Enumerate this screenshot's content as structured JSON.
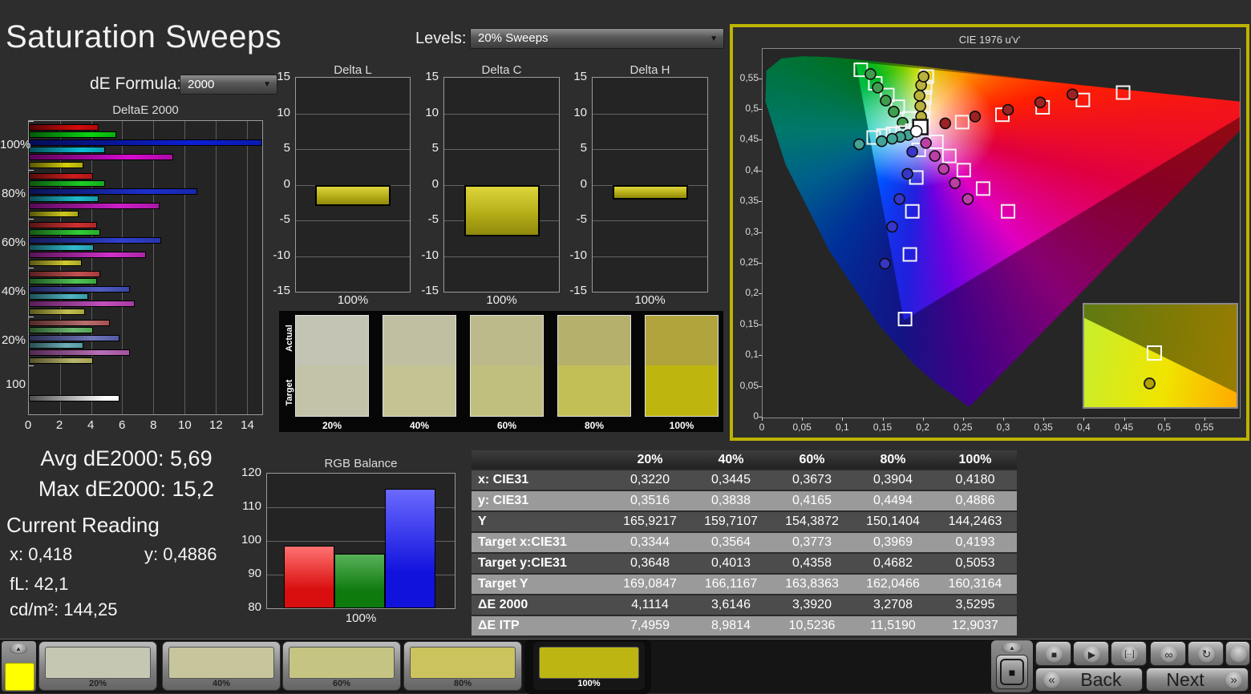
{
  "header": {
    "title": "Saturation Sweeps",
    "de_formula_label": "dE Formula:",
    "de_formula_value": "2000",
    "levels_label": "Levels:",
    "levels_value": "20% Sweeps"
  },
  "colors": {
    "background": "#2d2d2d",
    "panel_accent_border": "#bdb400",
    "mini_swatch": "#ffff00",
    "delta_bar": "#c9c21b"
  },
  "chart_data": [
    {
      "id": "deltae2000",
      "type": "bar",
      "title": "DeltaE 2000",
      "orientation": "horizontal",
      "xlim": [
        0,
        15
      ],
      "xtick_values": [
        0,
        2,
        4,
        6,
        8,
        10,
        12,
        14
      ],
      "xtick_labels": [
        "0",
        "2",
        "4",
        "6",
        "8",
        "10",
        "12",
        "14"
      ],
      "series_names": [
        "red",
        "green",
        "blue",
        "cyan",
        "magenta",
        "yellow"
      ],
      "groups": [
        {
          "label": "100%",
          "values": [
            4.5,
            5.6,
            15.2,
            4.9,
            9.3,
            3.5
          ]
        },
        {
          "label": "80%",
          "values": [
            4.1,
            4.9,
            10.8,
            4.5,
            8.4,
            3.2
          ]
        },
        {
          "label": "60%",
          "values": [
            4.4,
            4.6,
            8.5,
            4.2,
            7.5,
            3.4
          ]
        },
        {
          "label": "40%",
          "values": [
            4.6,
            4.4,
            6.5,
            3.8,
            6.8,
            3.6
          ]
        },
        {
          "label": "20%",
          "values": [
            5.2,
            4.1,
            5.8,
            3.5,
            6.5,
            4.1
          ]
        },
        {
          "label": "100",
          "white_value": 5.8
        }
      ]
    },
    {
      "id": "delta_l",
      "type": "bar",
      "title": "Delta L",
      "xlabel": "100%",
      "ylim": [
        -15,
        15
      ],
      "ytick_labels": [
        "15",
        "10",
        "5",
        "0",
        "-5",
        "-10",
        "-15"
      ],
      "value": -3.0
    },
    {
      "id": "delta_c",
      "type": "bar",
      "title": "Delta C",
      "xlabel": "100%",
      "ylim": [
        -15,
        15
      ],
      "ytick_labels": [
        "15",
        "10",
        "5",
        "0",
        "-5",
        "-10",
        "-15"
      ],
      "value": -7.3
    },
    {
      "id": "delta_h",
      "type": "bar",
      "title": "Delta H",
      "xlabel": "100%",
      "ylim": [
        -15,
        15
      ],
      "ytick_labels": [
        "15",
        "10",
        "5",
        "0",
        "-5",
        "-10",
        "-15"
      ],
      "value": -2.1
    },
    {
      "id": "rgb_balance",
      "type": "bar",
      "title": "RGB Balance",
      "xlabel": "100%",
      "ylim": [
        80,
        120
      ],
      "ytick_values": [
        120,
        110,
        100,
        90,
        80
      ],
      "ytick_labels": [
        "120",
        "110",
        "100",
        "90",
        "80"
      ],
      "series": [
        {
          "name": "Red",
          "value": 98.5,
          "color_top": "#ff7272",
          "color_bottom": "#d90f0f"
        },
        {
          "name": "Green",
          "value": 96.2,
          "color_top": "#58b158",
          "color_bottom": "#0e7a0e"
        },
        {
          "name": "Blue",
          "value": 115.5,
          "color_top": "#6a6aff",
          "color_bottom": "#1212dd"
        }
      ]
    },
    {
      "id": "cie_1976",
      "type": "scatter",
      "title": "CIE 1976 u'v'",
      "xlim": [
        0,
        0.593
      ],
      "ylim": [
        0,
        0.599
      ],
      "xtick_values": [
        0,
        0.05,
        0.1,
        0.15,
        0.2,
        0.25,
        0.3,
        0.35,
        0.4,
        0.45,
        0.5,
        0.55
      ],
      "xtick_labels": [
        "0",
        "0,05",
        "0,1",
        "0,15",
        "0,2",
        "0,25",
        "0,3",
        "0,35",
        "0,4",
        "0,45",
        "0,5",
        "0,55"
      ],
      "ytick_values": [
        0,
        0.05,
        0.1,
        0.15,
        0.2,
        0.25,
        0.3,
        0.35,
        0.4,
        0.45,
        0.5,
        0.55
      ],
      "ytick_labels": [
        "0",
        "0,05",
        "0,1",
        "0,15",
        "0,2",
        "0,25",
        "0,3",
        "0,35",
        "0,4",
        "0,45",
        "0,5",
        "0,55"
      ],
      "white_point": {
        "target": [
          0.196,
          0.472
        ],
        "measured": [
          0.191,
          0.465
        ]
      },
      "series": [
        {
          "name": "red-targets",
          "marker": "square",
          "points": [
            [
              0.248,
              0.48
            ],
            [
              0.298,
              0.492
            ],
            [
              0.348,
              0.504
            ],
            [
              0.398,
              0.516
            ],
            [
              0.448,
              0.528
            ]
          ]
        },
        {
          "name": "red-measured",
          "marker": "circle",
          "color": "#9c2323",
          "points": [
            [
              0.227,
              0.478
            ],
            [
              0.264,
              0.489
            ],
            [
              0.305,
              0.5
            ],
            [
              0.345,
              0.512
            ],
            [
              0.385,
              0.525
            ]
          ]
        },
        {
          "name": "green-targets",
          "marker": "square",
          "points": [
            [
              0.182,
              0.486
            ],
            [
              0.168,
              0.505
            ],
            [
              0.155,
              0.524
            ],
            [
              0.14,
              0.543
            ],
            [
              0.122,
              0.565
            ]
          ]
        },
        {
          "name": "green-measured",
          "marker": "circle",
          "color": "#3f9e4d",
          "points": [
            [
              0.174,
              0.479
            ],
            [
              0.163,
              0.497
            ],
            [
              0.153,
              0.515
            ],
            [
              0.143,
              0.536
            ],
            [
              0.134,
              0.558
            ]
          ]
        },
        {
          "name": "blue-targets",
          "marker": "square",
          "points": [
            [
              0.194,
              0.435
            ],
            [
              0.191,
              0.39
            ],
            [
              0.186,
              0.335
            ],
            [
              0.183,
              0.265
            ],
            [
              0.177,
              0.16
            ]
          ]
        },
        {
          "name": "blue-measured",
          "marker": "circle",
          "color": "#3636c8",
          "points": [
            [
              0.186,
              0.432
            ],
            [
              0.18,
              0.396
            ],
            [
              0.17,
              0.355
            ],
            [
              0.161,
              0.31
            ],
            [
              0.152,
              0.25
            ]
          ]
        },
        {
          "name": "cyan-targets",
          "marker": "square",
          "points": [
            [
              0.186,
              0.466
            ],
            [
              0.174,
              0.463
            ],
            [
              0.162,
              0.461
            ],
            [
              0.15,
              0.458
            ],
            [
              0.138,
              0.455
            ]
          ]
        },
        {
          "name": "cyan-measured",
          "marker": "circle",
          "color": "#43a395",
          "points": [
            [
              0.181,
              0.459
            ],
            [
              0.171,
              0.456
            ],
            [
              0.161,
              0.453
            ],
            [
              0.148,
              0.449
            ],
            [
              0.12,
              0.444
            ]
          ]
        },
        {
          "name": "magenta-targets",
          "marker": "square",
          "points": [
            [
              0.216,
              0.448
            ],
            [
              0.232,
              0.425
            ],
            [
              0.25,
              0.402
            ],
            [
              0.274,
              0.372
            ],
            [
              0.305,
              0.335
            ]
          ]
        },
        {
          "name": "magenta-measured",
          "marker": "circle",
          "color": "#bb3fa5",
          "points": [
            [
              0.203,
              0.446
            ],
            [
              0.214,
              0.425
            ],
            [
              0.225,
              0.404
            ],
            [
              0.239,
              0.381
            ],
            [
              0.255,
              0.355
            ]
          ]
        },
        {
          "name": "yellow-targets",
          "marker": "square",
          "points": [
            [
              0.199,
              0.486
            ],
            [
              0.2,
              0.503
            ],
            [
              0.201,
              0.52
            ],
            [
              0.202,
              0.537
            ],
            [
              0.204,
              0.554
            ]
          ]
        },
        {
          "name": "yellow-measured",
          "marker": "circle",
          "color": "#b9b23c",
          "points": [
            [
              0.197,
              0.489
            ],
            [
              0.196,
              0.506
            ],
            [
              0.195,
              0.523
            ],
            [
              0.197,
              0.54
            ],
            [
              0.2,
              0.554
            ]
          ]
        }
      ],
      "inset": {
        "square_pos": [
          0.455,
          0.46
        ],
        "circle_pos": [
          0.42,
          0.76
        ],
        "circle_color": "#b3a300"
      }
    }
  ],
  "swatch_compare": {
    "actual_label": "Actual",
    "target_label": "Target",
    "levels": [
      "20%",
      "40%",
      "60%",
      "80%",
      "100%"
    ],
    "actual_colors": [
      "#c3c4b3",
      "#c0bfa1",
      "#bcba8b",
      "#b6b06d",
      "#b1a43c"
    ],
    "target_colors": [
      "#c3c3aa",
      "#c4c394",
      "#c1bf7e",
      "#c3bf57",
      "#beb60e"
    ]
  },
  "stats": {
    "avg": "Avg dE2000: 5,69",
    "max": "Max dE2000: 15,2",
    "current_reading": "Current Reading",
    "x": "x: 0,418",
    "y": "y: 0,4886",
    "fl": "fL: 42,1",
    "cdm2": "cd/m²: 144,25"
  },
  "table": {
    "columns": [
      "",
      "20%",
      "40%",
      "60%",
      "80%",
      "100%"
    ],
    "rows": [
      {
        "label": "x: CIE31",
        "values": [
          "0,3220",
          "0,3445",
          "0,3673",
          "0,3904",
          "0,4180"
        ]
      },
      {
        "label": "y: CIE31",
        "values": [
          "0,3516",
          "0,3838",
          "0,4165",
          "0,4494",
          "0,4886"
        ]
      },
      {
        "label": "Y",
        "values": [
          "165,9217",
          "159,7107",
          "154,3872",
          "150,1404",
          "144,2463"
        ]
      },
      {
        "label": "Target x:CIE31",
        "values": [
          "0,3344",
          "0,3564",
          "0,3773",
          "0,3969",
          "0,4193"
        ]
      },
      {
        "label": "Target y:CIE31",
        "values": [
          "0,3648",
          "0,4013",
          "0,4358",
          "0,4682",
          "0,5053"
        ]
      },
      {
        "label": "Target Y",
        "values": [
          "169,0847",
          "166,1167",
          "163,8363",
          "162,0466",
          "160,3164"
        ]
      },
      {
        "label": "ΔE 2000",
        "values": [
          "4,1114",
          "3,6146",
          "3,3920",
          "3,2708",
          "3,5295"
        ]
      },
      {
        "label": "ΔE ITP",
        "values": [
          "7,4959",
          "8,9814",
          "10,5236",
          "11,5190",
          "12,9037"
        ]
      }
    ]
  },
  "bottom_bar": {
    "mini_swatch_color": "#ffff00",
    "patches": [
      {
        "label": "20%",
        "color": "#c6c7b3"
      },
      {
        "label": "40%",
        "color": "#c7c59c"
      },
      {
        "label": "60%",
        "color": "#c6c483"
      },
      {
        "label": "80%",
        "color": "#cbc45e"
      },
      {
        "label": "100%",
        "color": "#bdb512"
      }
    ],
    "selected_index": 4
  },
  "transport": {
    "back": "Back",
    "next": "Next"
  },
  "icons": {
    "up": "▲",
    "stop": "■",
    "play": "▶",
    "loop_range": "[··]",
    "infinity": "∞",
    "refresh": "↻",
    "back_chevron": "«",
    "next_chevron": "»"
  }
}
